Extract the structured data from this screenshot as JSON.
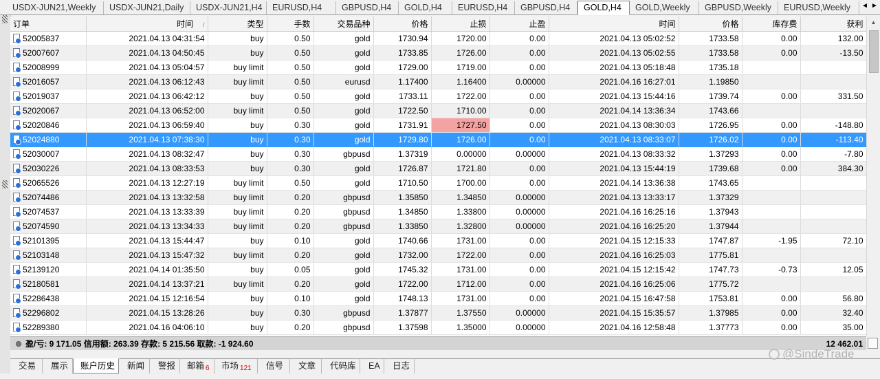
{
  "chart_tabs": [
    {
      "label": "USDX-JUN21,Weekly",
      "active": false
    },
    {
      "label": "USDX-JUN21,Daily",
      "active": false
    },
    {
      "label": "USDX-JUN21,H4",
      "active": false
    },
    {
      "label": "EURUSD,H4",
      "active": false
    },
    {
      "label": "GBPUSD,H4",
      "active": false
    },
    {
      "label": "GOLD,H4",
      "active": false
    },
    {
      "label": "EURUSD,H4",
      "active": false
    },
    {
      "label": "GBPUSD,H4",
      "active": false
    },
    {
      "label": "GOLD,H4",
      "active": true
    },
    {
      "label": "GOLD,Weekly",
      "active": false
    },
    {
      "label": "GBPUSD,Weekly",
      "active": false
    },
    {
      "label": "EURUSD,Weekly",
      "active": false
    }
  ],
  "tab_scroll": {
    "left": "◄",
    "right": "►"
  },
  "columns": [
    "订单",
    "时间",
    "类型",
    "手数",
    "交易品种",
    "价格",
    "止损",
    "止盈",
    "时间",
    "价格",
    "库存费",
    "获利"
  ],
  "rows": [
    {
      "order": "52005837",
      "open_time": "2021.04.13 04:31:54",
      "type": "buy",
      "lots": "0.50",
      "symbol": "gold",
      "open_price": "1730.94",
      "sl": "1720.00",
      "tp": "0.00",
      "close_time": "2021.04.13 05:02:52",
      "close_price": "1733.58",
      "swap": "0.00",
      "profit": "132.00"
    },
    {
      "order": "52007607",
      "open_time": "2021.04.13 04:50:45",
      "type": "buy",
      "lots": "0.50",
      "symbol": "gold",
      "open_price": "1733.85",
      "sl": "1726.00",
      "tp": "0.00",
      "close_time": "2021.04.13 05:02:55",
      "close_price": "1733.58",
      "swap": "0.00",
      "profit": "-13.50"
    },
    {
      "order": "52008999",
      "open_time": "2021.04.13 05:04:57",
      "type": "buy limit",
      "lots": "0.50",
      "symbol": "gold",
      "open_price": "1729.00",
      "sl": "1719.00",
      "tp": "0.00",
      "close_time": "2021.04.13 05:18:48",
      "close_price": "1735.18",
      "swap": "",
      "profit": ""
    },
    {
      "order": "52016057",
      "open_time": "2021.04.13 06:12:43",
      "type": "buy limit",
      "lots": "0.50",
      "symbol": "eurusd",
      "open_price": "1.17400",
      "sl": "1.16400",
      "tp": "0.00000",
      "close_time": "2021.04.16 16:27:01",
      "close_price": "1.19850",
      "swap": "",
      "profit": ""
    },
    {
      "order": "52019037",
      "open_time": "2021.04.13 06:42:12",
      "type": "buy",
      "lots": "0.50",
      "symbol": "gold",
      "open_price": "1733.11",
      "sl": "1722.00",
      "tp": "0.00",
      "close_time": "2021.04.13 15:44:16",
      "close_price": "1739.74",
      "swap": "0.00",
      "profit": "331.50"
    },
    {
      "order": "52020067",
      "open_time": "2021.04.13 06:52:00",
      "type": "buy limit",
      "lots": "0.50",
      "symbol": "gold",
      "open_price": "1722.50",
      "sl": "1710.00",
      "tp": "0.00",
      "close_time": "2021.04.14 13:36:34",
      "close_price": "1743.66",
      "swap": "",
      "profit": ""
    },
    {
      "order": "52020846",
      "open_time": "2021.04.13 06:59:40",
      "type": "buy",
      "lots": "0.30",
      "symbol": "gold",
      "open_price": "1731.91",
      "sl": "1727.50",
      "tp": "0.00",
      "close_time": "2021.04.13 08:30:03",
      "close_price": "1726.95",
      "swap": "0.00",
      "profit": "-148.80",
      "sl_highlight": true
    },
    {
      "order": "52024880",
      "open_time": "2021.04.13 07:38:30",
      "type": "buy",
      "lots": "0.30",
      "symbol": "gold",
      "open_price": "1729.80",
      "sl": "1726.00",
      "tp": "0.00",
      "close_time": "2021.04.13 08:33:07",
      "close_price": "1726.02",
      "swap": "0.00",
      "profit": "-113.40",
      "selected": true
    },
    {
      "order": "52030007",
      "open_time": "2021.04.13 08:32:47",
      "type": "buy",
      "lots": "0.30",
      "symbol": "gbpusd",
      "open_price": "1.37319",
      "sl": "0.00000",
      "tp": "0.00000",
      "close_time": "2021.04.13 08:33:32",
      "close_price": "1.37293",
      "swap": "0.00",
      "profit": "-7.80"
    },
    {
      "order": "52030226",
      "open_time": "2021.04.13 08:33:53",
      "type": "buy",
      "lots": "0.30",
      "symbol": "gold",
      "open_price": "1726.87",
      "sl": "1721.80",
      "tp": "0.00",
      "close_time": "2021.04.13 15:44:19",
      "close_price": "1739.68",
      "swap": "0.00",
      "profit": "384.30"
    },
    {
      "order": "52065526",
      "open_time": "2021.04.13 12:27:19",
      "type": "buy limit",
      "lots": "0.50",
      "symbol": "gold",
      "open_price": "1710.50",
      "sl": "1700.00",
      "tp": "0.00",
      "close_time": "2021.04.14 13:36:38",
      "close_price": "1743.65",
      "swap": "",
      "profit": ""
    },
    {
      "order": "52074486",
      "open_time": "2021.04.13 13:32:58",
      "type": "buy limit",
      "lots": "0.20",
      "symbol": "gbpusd",
      "open_price": "1.35850",
      "sl": "1.34850",
      "tp": "0.00000",
      "close_time": "2021.04.13 13:33:17",
      "close_price": "1.37329",
      "swap": "",
      "profit": ""
    },
    {
      "order": "52074537",
      "open_time": "2021.04.13 13:33:39",
      "type": "buy limit",
      "lots": "0.20",
      "symbol": "gbpusd",
      "open_price": "1.34850",
      "sl": "1.33800",
      "tp": "0.00000",
      "close_time": "2021.04.16 16:25:16",
      "close_price": "1.37943",
      "swap": "",
      "profit": ""
    },
    {
      "order": "52074590",
      "open_time": "2021.04.13 13:34:33",
      "type": "buy limit",
      "lots": "0.20",
      "symbol": "gbpusd",
      "open_price": "1.33850",
      "sl": "1.32800",
      "tp": "0.00000",
      "close_time": "2021.04.16 16:25:20",
      "close_price": "1.37944",
      "swap": "",
      "profit": ""
    },
    {
      "order": "52101395",
      "open_time": "2021.04.13 15:44:47",
      "type": "buy",
      "lots": "0.10",
      "symbol": "gold",
      "open_price": "1740.66",
      "sl": "1731.00",
      "tp": "0.00",
      "close_time": "2021.04.15 12:15:33",
      "close_price": "1747.87",
      "swap": "-1.95",
      "profit": "72.10"
    },
    {
      "order": "52103148",
      "open_time": "2021.04.13 15:47:32",
      "type": "buy limit",
      "lots": "0.20",
      "symbol": "gold",
      "open_price": "1732.00",
      "sl": "1722.00",
      "tp": "0.00",
      "close_time": "2021.04.16 16:25:03",
      "close_price": "1775.81",
      "swap": "",
      "profit": ""
    },
    {
      "order": "52139120",
      "open_time": "2021.04.14 01:35:50",
      "type": "buy",
      "lots": "0.05",
      "symbol": "gold",
      "open_price": "1745.32",
      "sl": "1731.00",
      "tp": "0.00",
      "close_time": "2021.04.15 12:15:42",
      "close_price": "1747.73",
      "swap": "-0.73",
      "profit": "12.05"
    },
    {
      "order": "52180581",
      "open_time": "2021.04.14 13:37:21",
      "type": "buy limit",
      "lots": "0.20",
      "symbol": "gold",
      "open_price": "1722.00",
      "sl": "1712.00",
      "tp": "0.00",
      "close_time": "2021.04.16 16:25:06",
      "close_price": "1775.72",
      "swap": "",
      "profit": ""
    },
    {
      "order": "52286438",
      "open_time": "2021.04.15 12:16:54",
      "type": "buy",
      "lots": "0.10",
      "symbol": "gold",
      "open_price": "1748.13",
      "sl": "1731.00",
      "tp": "0.00",
      "close_time": "2021.04.15 16:47:58",
      "close_price": "1753.81",
      "swap": "0.00",
      "profit": "56.80"
    },
    {
      "order": "52296802",
      "open_time": "2021.04.15 13:28:26",
      "type": "buy",
      "lots": "0.30",
      "symbol": "gbpusd",
      "open_price": "1.37877",
      "sl": "1.37550",
      "tp": "0.00000",
      "close_time": "2021.04.15 15:35:57",
      "close_price": "1.37985",
      "swap": "0.00",
      "profit": "32.40"
    },
    {
      "order": "52289380",
      "open_time": "2021.04.16 04:06:10",
      "type": "buy",
      "lots": "0.20",
      "symbol": "gbpusd",
      "open_price": "1.37598",
      "sl": "1.35000",
      "tp": "0.00000",
      "close_time": "2021.04.16 12:58:48",
      "close_price": "1.37773",
      "swap": "0.00",
      "profit": "35.00"
    }
  ],
  "summary": {
    "text": "盈/亏: 9 171.05  信用额: 263.39  存款: 5 215.56  取款: -1 924.60",
    "total": "12 462.01"
  },
  "bottom_tabs": [
    {
      "label": "交易",
      "active": false,
      "badge": ""
    },
    {
      "label": "展示",
      "active": false,
      "badge": ""
    },
    {
      "label": "账户历史",
      "active": true,
      "badge": ""
    },
    {
      "label": "新闻",
      "active": false,
      "badge": ""
    },
    {
      "label": "警报",
      "active": false,
      "badge": ""
    },
    {
      "label": "邮箱",
      "active": false,
      "badge": "6"
    },
    {
      "label": "市场",
      "active": false,
      "badge": "121"
    },
    {
      "label": "信号",
      "active": false,
      "badge": ""
    },
    {
      "label": "文章",
      "active": false,
      "badge": ""
    },
    {
      "label": "代码库",
      "active": false,
      "badge": ""
    },
    {
      "label": "EA",
      "active": false,
      "badge": ""
    },
    {
      "label": "日志",
      "active": false,
      "badge": ""
    }
  ],
  "watermark": "@SindeTrade",
  "colors": {
    "selection": "#3399ff",
    "sl_highlight": "#f4a3a3",
    "summary_bg": "#d4d4d4"
  }
}
